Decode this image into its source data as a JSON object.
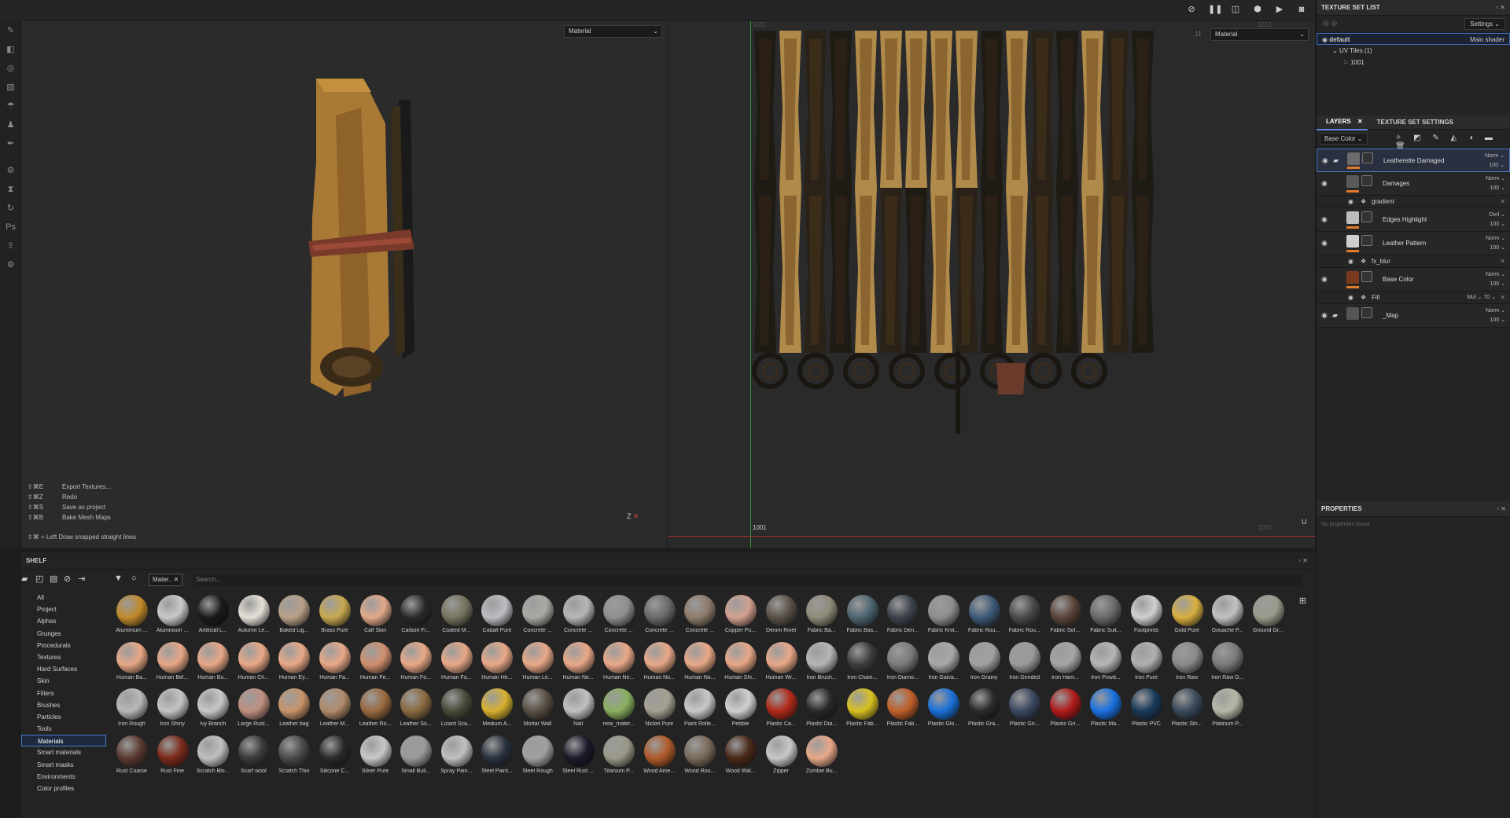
{
  "viewport3d": {
    "material_select": "Material",
    "axis_label": "Z",
    "shortcuts": [
      {
        "key": "⇧⌘E",
        "action": "Export Textures..."
      },
      {
        "key": "⇧⌘Z",
        "action": "Redo"
      },
      {
        "key": "⇧⌘S",
        "action": "Save as project"
      },
      {
        "key": "⇧⌘B",
        "action": "Bake Mesh Maps"
      }
    ],
    "hint": "⇧⌘ + Left  Draw snapped straight lines"
  },
  "viewport2d": {
    "material_select": "Material",
    "tile_label": "1001",
    "tile_top_left": "1011",
    "tile_top_right": "1012",
    "tile_bottom_right": "1002",
    "axis_label": "U"
  },
  "texture_set_list": {
    "title": "TEXTURE SET LIST",
    "settings_btn": "Settings",
    "default_label": "default",
    "shader_label": "Main shader",
    "uv_tiles": "UV Tiles (1)",
    "tile": "1001"
  },
  "layers": {
    "tab_layers": "LAYERS",
    "tab_tss": "TEXTURE SET SETTINGS",
    "channel": "Base Color",
    "items": [
      {
        "name": "Leatherette Damaged",
        "blend": "Norm",
        "opacity": "100",
        "thumb": "#6b6b6b"
      },
      {
        "name": "Damages",
        "blend": "Norm",
        "opacity": "100",
        "thumb": "#5a5a5a"
      },
      {
        "name": "Edges Highlight",
        "blend": "Ovrl",
        "opacity": "100",
        "thumb": "#bdbdbd"
      },
      {
        "name": "Leather Pattern",
        "blend": "Norm",
        "opacity": "100",
        "thumb": "#cfcfcf"
      },
      {
        "name": "Base Color",
        "blend": "Norm",
        "opacity": "100",
        "thumb": "#7a3a1f"
      },
      {
        "name": "_Map",
        "blend": "Norm",
        "opacity": "100",
        "thumb": "#555555"
      }
    ],
    "sub": [
      {
        "name": "gradient"
      },
      {
        "name": "fx_blur"
      },
      {
        "name": "Fill",
        "blend": "Mul",
        "opacity": "70"
      }
    ]
  },
  "properties": {
    "title": "PROPERTIES",
    "empty": "No properties found"
  },
  "shelf": {
    "title": "SHELF",
    "filter": "Mater..",
    "search_placeholder": "Search...",
    "categories": [
      "All",
      "Project",
      "Alphas",
      "Grunges",
      "Procedurals",
      "Textures",
      "Hard Surfaces",
      "Skin",
      "Filters",
      "Brushes",
      "Particles",
      "Tools",
      "Materials",
      "Smart materials",
      "Smart masks",
      "Environments",
      "Color profiles"
    ],
    "materials": [
      [
        "Aluminium ...",
        "#c08a2a"
      ],
      [
        "Aluminium ...",
        "#c9c9c9"
      ],
      [
        "Artificial L...",
        "#1a1a1a"
      ],
      [
        "Autumn Le...",
        "#e6e0d8"
      ],
      [
        "Baked Lig...",
        "#b8a088"
      ],
      [
        "Brass Pure",
        "#c8a850"
      ],
      [
        "Calf Skin",
        "#e0a88a"
      ],
      [
        "Carbon Fi...",
        "#2a2a2a"
      ],
      [
        "Coated M...",
        "#77735f"
      ],
      [
        "Cobalt Pure",
        "#bdbdc2"
      ],
      [
        "Concrete ...",
        "#a9a9a4"
      ],
      [
        "Concrete ...",
        "#b6b6b6"
      ],
      [
        "Concrete ...",
        "#8f8f8f"
      ],
      [
        "Concrete ...",
        "#6a6a6a"
      ],
      [
        "Concrete ...",
        "#8e7c6c"
      ],
      [
        "Copper Pu...",
        "#d2a090"
      ],
      [
        "Denim Rivet",
        "#5a5148"
      ],
      [
        "Fabric Ba...",
        "#8f8a78"
      ],
      [
        "Fabric Bas...",
        "#4d6470"
      ],
      [
        "Fabric Den...",
        "#3d434c"
      ],
      [
        "Fabric Knit...",
        "#8e8e8e"
      ],
      [
        "Fabric Rou...",
        "#3e5a78"
      ],
      [
        "Fabric Rou...",
        "#4a4a4a"
      ],
      [
        "Fabric Sof...",
        "#5a4438"
      ],
      [
        "Fabric Suit...",
        "#6a6a6a"
      ],
      [
        "Footprints",
        "#d0d0d0"
      ],
      [
        "Gold Pure",
        "#d8b040"
      ],
      [
        "Gouache P...",
        "#c2c2c2"
      ],
      [
        "Ground Gr...",
        "#9a9a8a"
      ],
      [
        "Human Ba...",
        "#e8a888"
      ],
      [
        "Human Bel...",
        "#e8a888"
      ],
      [
        "Human Bu...",
        "#e8a888"
      ],
      [
        "Human Ch...",
        "#e8a888"
      ],
      [
        "Human Ey...",
        "#e8a888"
      ],
      [
        "Human Fa...",
        "#e8a888"
      ],
      [
        "Human Fe...",
        "#d09070"
      ],
      [
        "Human Fo...",
        "#e8a888"
      ],
      [
        "Human Fo...",
        "#e8a888"
      ],
      [
        "Human He...",
        "#e8a888"
      ],
      [
        "Human Le...",
        "#e8a888"
      ],
      [
        "Human Ne...",
        "#e8a888"
      ],
      [
        "Human Ne...",
        "#e8a888"
      ],
      [
        "Human No...",
        "#e8a888"
      ],
      [
        "Human No...",
        "#e8a888"
      ],
      [
        "Human Shi...",
        "#e8a888"
      ],
      [
        "Human Wr...",
        "#e8a888"
      ],
      [
        "Iron Brush...",
        "#b5b5b5"
      ],
      [
        "Iron Chain...",
        "#3c3c3c"
      ],
      [
        "Iron Diamo...",
        "#7a7a7a"
      ],
      [
        "Iron Galva...",
        "#a8a8a8"
      ],
      [
        "Iron Grainy",
        "#a0a0a0"
      ],
      [
        "Iron Grinded",
        "#9a9a9a"
      ],
      [
        "Iron Ham...",
        "#a5a5a5"
      ],
      [
        "Iron Powd...",
        "#b5b5b5"
      ],
      [
        "Iron Pure",
        "#b0b0b0"
      ],
      [
        "Iron Raw",
        "#8a8a8a"
      ],
      [
        "Iron Raw D...",
        "#7a7a7a"
      ],
      [
        "Iron Rough",
        "#b8b8b8"
      ],
      [
        "Iron Shiny",
        "#c5c5c5"
      ],
      [
        "Ivy Branch",
        "#c8c8c8"
      ],
      [
        "Large Rust...",
        "#c09080"
      ],
      [
        "Leather bag",
        "#c8946a"
      ],
      [
        "Leather M...",
        "#b08a6a"
      ],
      [
        "Leather Ro...",
        "#9a6a40"
      ],
      [
        "Leather So...",
        "#8a6a40"
      ],
      [
        "Lizard Sca...",
        "#4a4a3a"
      ],
      [
        "Medium A...",
        "#d8b030"
      ],
      [
        "Mortar Wall",
        "#5a5045"
      ],
      [
        "Nail",
        "#c0c0c0"
      ],
      [
        "new_mater...",
        "#8ab060"
      ],
      [
        "Nickel Pure",
        "#a5a090"
      ],
      [
        "Paint Rolle...",
        "#c8c8c8"
      ],
      [
        "Pebble",
        "#d0d0d0"
      ],
      [
        "Plastic Ca...",
        "#b02a1a"
      ],
      [
        "Plastic Dia...",
        "#2a2a2a"
      ],
      [
        "Plastic Fab...",
        "#d8c020"
      ],
      [
        "Plastic Fab...",
        "#c0602a"
      ],
      [
        "Plastic Glo...",
        "#1a70d8"
      ],
      [
        "Plastic Gra...",
        "#2a2a2a"
      ],
      [
        "Plastic Gri...",
        "#3a4860"
      ],
      [
        "Plastic Gri...",
        "#b01a1a"
      ],
      [
        "Plastic Ma...",
        "#1a70e0"
      ],
      [
        "Plastic PVC",
        "#1a3a5a"
      ],
      [
        "Plastic Stri...",
        "#3a4a5a"
      ],
      [
        "Platinum P...",
        "#b8b8a8"
      ],
      [
        "Rust Coarse",
        "#5a3a30"
      ],
      [
        "Rust Fine",
        "#7a2a1a"
      ],
      [
        "Scratch Blo...",
        "#c0c0c0"
      ],
      [
        "Scarf wool",
        "#3a3a3a"
      ],
      [
        "Scratch Thin",
        "#4a4a4a"
      ],
      [
        "Silicone C...",
        "#2a2a2a"
      ],
      [
        "Silver Pure",
        "#c8c8c8"
      ],
      [
        "Small Bull...",
        "#9a9a9a"
      ],
      [
        "Spray Pain...",
        "#c0c0c0"
      ],
      [
        "Steel Paint...",
        "#2a3240"
      ],
      [
        "Steel Rough",
        "#a0a0a0"
      ],
      [
        "Steel Rust ...",
        "#1a1a2a"
      ],
      [
        "Titanium P...",
        "#9a9888"
      ],
      [
        "Wood Ame...",
        "#b05a2a"
      ],
      [
        "Wood Rou...",
        "#7a6a5a"
      ],
      [
        "Wood Wal...",
        "#4a2a1a"
      ],
      [
        "Zipper",
        "#c8c8c8"
      ],
      [
        "Zombie Bu...",
        "#e8a888"
      ]
    ]
  }
}
